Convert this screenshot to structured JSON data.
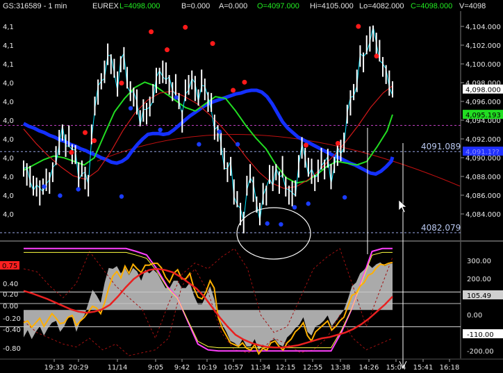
{
  "header": {
    "symbol": "GS:316589 - 1 min",
    "exchange": "EUREX",
    "last": "L=4098.000",
    "bid": "B=0.000",
    "ask": "A=0.000",
    "open": "O=4097.000",
    "high": "Hi=4105.000",
    "low": "Lo=4082.000",
    "close": "C=4098.000",
    "volume": "V=4098"
  },
  "colors": {
    "background": "#000000",
    "price_bars": "#ffffff",
    "price_line": "#00e5ff",
    "blue_ma": "#1430ff",
    "green_ma": "#22dd22",
    "red_ma": "#d01818",
    "swing_high_dot": "#ff1a1a",
    "swing_low_dot": "#1a3cff",
    "osc_main": "#ffb000",
    "osc_fill": "#c8c8c8",
    "osc_magenta": "#ff40ff",
    "osc_yellow": "#ffff40"
  },
  "chart_data": [
    {
      "type": "line",
      "panel": "price",
      "title": "",
      "ylim": [
        4082,
        4106
      ],
      "y_ticks_right": [
        "4,104.000",
        "4,102.000",
        "4,100.000",
        "4,098.000",
        "4,096.000",
        "4,094.000",
        "4,092.000",
        "4,090.000",
        "4,088.000",
        "4,086.000",
        "4,084.000"
      ],
      "y_ticks_left": [
        "4,1",
        "4,1",
        "4,1",
        "4,0",
        "4,0",
        "4,0",
        "4,0",
        "4,0",
        "4,0",
        "4,0",
        "4,0"
      ],
      "price_badges": [
        {
          "label": "4,098.000",
          "value": 4098.0,
          "bg": "#ffffff",
          "fg": "#000000"
        },
        {
          "label": "4,095.193",
          "value": 4095.19,
          "bg": "#22dd22",
          "fg": "#000000"
        },
        {
          "label": "4,091.1??",
          "value": 4091.1,
          "bg": "#2030ff",
          "fg": "#9090ff"
        }
      ],
      "horizontal_levels": [
        {
          "label": "4091.089",
          "value": 4091.089
        },
        {
          "label": "4082.079",
          "value": 4082.079
        }
      ],
      "dashed_magenta_level": 4094.0,
      "close_series": [
        4089.2,
        4088.6,
        4088.0,
        4087.5,
        4087.0,
        4086.4,
        4087.2,
        4088.0,
        4087.3,
        4089.0,
        4090.5,
        4092.0,
        4093.2,
        4091.8,
        4092.5,
        4091.0,
        4090.6,
        4088.4,
        4089.2,
        4088.2,
        4087.0,
        4093.2,
        4096.0,
        4097.6,
        4098.9,
        4100.0,
        4101.6,
        4101.0,
        4100.2,
        4098.5,
        4100.8,
        4101.5,
        4099.0,
        4098.0,
        4097.0,
        4096.5,
        4094.8,
        4095.7,
        4095.0,
        4096.3,
        4097.4,
        4098.9,
        4099.5,
        4100.0,
        4099.5,
        4098.7,
        4097.6,
        4098.2,
        4096.7,
        4094.5,
        4097.6,
        4098.7,
        4098.9,
        4098.0,
        4097.1,
        4099.0,
        4097.7,
        4096.8,
        4096.4,
        4093.7,
        4093.1,
        4092.0,
        4090.0,
        4089.0,
        4089.3,
        4086.5,
        4085.8,
        4084.2,
        4082.9,
        4087.5,
        4088.5,
        4086.8,
        4085.2,
        4084.2,
        4086.1,
        4086.4,
        4088.4,
        4088.0,
        4088.8,
        4087.7,
        4089.1,
        4087.4,
        4086.1,
        4086.3,
        4087.0,
        4089.5,
        4091.2,
        4090.6,
        4089.2,
        4088.8,
        4087.6,
        4089.0,
        4090.0,
        4089.3,
        4090.2,
        4088.2,
        4089.6,
        4090.8,
        4090.9,
        4092.3,
        4095.1,
        4096.4,
        4097.7,
        4099.0,
        4101.4,
        4101.2,
        4102.8,
        4103.5,
        4104.2,
        4103.1,
        4102.0,
        4100.7,
        4099.5,
        4098.6,
        4098.0
      ],
      "series": [
        {
          "name": "",
          "values": [
            4094.2,
            4093.9,
            4093.7,
            4093.4,
            4093.2,
            4092.9,
            4092.7,
            4092.4,
            4092.2,
            4091.9,
            4091.7,
            4091.4,
            4091.2,
            4090.9,
            4090.7,
            4090.4,
            4090.2,
            4089.9,
            4089.8,
            4090.0,
            4090.4,
            4091.2,
            4091.9,
            4092.5,
            4093.0,
            4093.1,
            4093.1,
            4093.0,
            4093.1,
            4093.5,
            4094.0,
            4094.5,
            4095.0,
            4095.4,
            4095.8,
            4096.2,
            4096.5,
            4096.7,
            4096.9,
            4097.1,
            4097.3,
            4097.5,
            4097.6,
            4097.8,
            4097.9,
            4097.9,
            4097.7,
            4097.2,
            4096.4,
            4095.4,
            4094.4,
            4093.7,
            4093.2,
            4092.7,
            4092.4,
            4092.1,
            4091.8,
            4091.5,
            4091.2,
            4090.9,
            4090.6,
            4090.4,
            4090.1,
            4089.8,
            4089.6,
            4089.3,
            4089.0,
            4088.7,
            4088.6,
            4088.9,
            4089.4,
            4090.0,
            4090.5
          ],
          "x_start": 0,
          "x_step": 1.6
        },
        {
          "name": "",
          "values": [
            4089.0,
            4089.6,
            4090.2,
            4090.6,
            4090.4,
            4090.0,
            4089.6,
            4090.4,
            4093.0,
            4095.5,
            4097.0,
            4098.2,
            4098.8,
            4098.4,
            4097.6,
            4096.8,
            4096.0,
            4095.6,
            4096.4,
            4097.2,
            4097.0,
            4095.6,
            4094.0,
            4092.6,
            4091.4,
            4089.6,
            4088.2,
            4087.6,
            4087.8,
            4088.5,
            4089.4,
            4090.0,
            4089.8,
            4089.6,
            4090.0,
            4091.6,
            4093.4,
            4095.2
          ],
          "x_start": 0,
          "x_step": 3.12
        },
        {
          "name": "",
          "values": [
            4093.6,
            4092.0,
            4090.6,
            4089.4,
            4088.4,
            4088.0,
            4089.0,
            4091.0,
            4093.4,
            4095.4,
            4096.8,
            4097.6,
            4097.8,
            4097.2,
            4096.4,
            4095.2,
            4093.8,
            4092.2,
            4090.4,
            4088.8,
            4087.6,
            4087.0,
            4087.2,
            4088.0,
            4089.2,
            4090.6,
            4092.2,
            4094.0,
            4096.0,
            4097.6,
            4098.4
          ],
          "x_start": 0,
          "x_step": 3.83
        }
      ],
      "swing_highs": [
        {
          "x": 21,
          "y": 4091.0
        },
        {
          "x": 27,
          "y": 4093.2
        },
        {
          "x": 31,
          "y": 4092.3
        },
        {
          "x": 43,
          "y": 4098.7
        },
        {
          "x": 56,
          "y": 4104.4
        },
        {
          "x": 63,
          "y": 4102.4
        },
        {
          "x": 71,
          "y": 4104.9
        },
        {
          "x": 83,
          "y": 4103.1
        },
        {
          "x": 92,
          "y": 4097.9
        },
        {
          "x": 97,
          "y": 4098.8
        },
        {
          "x": 124,
          "y": 4091.8
        },
        {
          "x": 138,
          "y": 4092.0
        },
        {
          "x": 147,
          "y": 4105.0
        },
        {
          "x": 155,
          "y": 4101.7
        }
      ],
      "swing_lows": [
        {
          "x": 9,
          "y": 4087.2
        },
        {
          "x": 16,
          "y": 4086.2
        },
        {
          "x": 24,
          "y": 4086.9
        },
        {
          "x": 43,
          "y": 4086.1
        },
        {
          "x": 47,
          "y": 4095.9
        },
        {
          "x": 60,
          "y": 4093.5
        },
        {
          "x": 67,
          "y": 4097.1
        },
        {
          "x": 77,
          "y": 4091.9
        },
        {
          "x": 86,
          "y": 4093.3
        },
        {
          "x": 94,
          "y": 4091.9
        },
        {
          "x": 107,
          "y": 4083.1
        },
        {
          "x": 113,
          "y": 4083.0
        },
        {
          "x": 119,
          "y": 4084.9
        },
        {
          "x": 125,
          "y": 4085.3
        },
        {
          "x": 141,
          "y": 4086.0
        }
      ]
    },
    {
      "type": "area",
      "panel": "oscillator",
      "title": "",
      "ylim_left": [
        -0.9,
        0.9
      ],
      "ylim_right": [
        -250,
        320
      ],
      "y_ticks_left": [
        "0.75",
        "0.40",
        "0.20",
        "0.00",
        "-0.20",
        "-0.40",
        "-0.80"
      ],
      "y_ticks_right": [
        "300.00",
        "200.00",
        "100.00",
        "0.00",
        "-100.00",
        "-200.00"
      ],
      "badges": [
        {
          "label": "0.75",
          "bg": "#ff2020"
        },
        {
          "label": "105.49",
          "bg": "#d0d0d0"
        },
        {
          "label": "-110.00",
          "bg": "#ffffff"
        }
      ],
      "horizontal_levels": [
        0.2,
        0.0,
        -0.4
      ],
      "main_series": [
        -70,
        -60,
        -95,
        -70,
        -45,
        -90,
        -55,
        -20,
        -45,
        -75,
        -70,
        -40,
        -30,
        -85,
        -60,
        -40,
        -10,
        20,
        10,
        -20,
        40,
        120,
        185,
        210,
        175,
        240,
        200,
        250,
        225,
        205,
        245,
        245,
        255,
        255,
        230,
        180,
        150,
        200,
        220,
        170,
        170,
        200,
        120,
        70,
        60,
        100,
        160,
        120,
        -40,
        -100,
        -140,
        -180,
        -190,
        -200,
        -180,
        -210,
        -220,
        -190,
        -240,
        -210,
        -220,
        -180,
        -170,
        -200,
        -220,
        -180,
        -160,
        -120,
        -100,
        -70,
        -140,
        -170,
        -120,
        -100,
        -80,
        -60,
        -110,
        -90,
        -60,
        -40,
        20,
        80,
        90,
        130,
        150,
        190,
        200,
        230,
        250,
        245,
        255,
        260
      ],
      "fill_series": [
        -150,
        -110,
        -160,
        -120,
        -90,
        -140,
        -100,
        -70,
        -60,
        -120,
        -90,
        -40,
        -40,
        -120,
        -60,
        -30,
        40,
        110,
        80,
        40,
        150,
        230,
        225,
        240,
        200,
        230,
        190,
        230,
        210,
        160,
        220,
        200,
        220,
        200,
        160,
        120,
        120,
        160,
        160,
        120,
        120,
        150,
        80,
        30,
        30,
        80,
        130,
        60,
        -40,
        -80,
        -120,
        -170,
        -180,
        -200,
        -160,
        -200,
        -200,
        -160,
        -220,
        -190,
        -210,
        -170,
        -160,
        -190,
        -200,
        -150,
        -130,
        -100,
        -80,
        -40,
        -120,
        -140,
        -90,
        -80,
        -60,
        -30,
        -90,
        -60,
        -30,
        0,
        60,
        130,
        150,
        200,
        220,
        250,
        230,
        250,
        260,
        240,
        250,
        255
      ],
      "red_series": [
        0.22,
        0.18,
        0.13,
        0.08,
        0.02,
        -0.04,
        -0.1,
        -0.14,
        -0.16,
        -0.14,
        -0.1,
        -0.02,
        0.12,
        0.28,
        0.42,
        0.52,
        0.58,
        0.6,
        0.58,
        0.54,
        0.46,
        0.36,
        0.26,
        0.12,
        -0.06,
        -0.24,
        -0.4,
        -0.54,
        -0.62,
        -0.68,
        -0.72,
        -0.75,
        -0.76,
        -0.76,
        -0.74,
        -0.72,
        -0.68,
        -0.64,
        -0.6,
        -0.58,
        -0.54,
        -0.5,
        -0.44,
        -0.36,
        -0.26,
        -0.14,
        -0.02,
        0.12
      ],
      "envelope_series": [
        0.95,
        0.95,
        0.95,
        0.95,
        0.95,
        0.95,
        0.95,
        0.95,
        0.95,
        0.95,
        0.95,
        0.9,
        0.84,
        0.6,
        0.3,
        0.1,
        -0.3,
        -0.7,
        -0.8,
        -0.82,
        -0.82,
        -0.82,
        -0.82,
        -0.82,
        -0.82,
        -0.82,
        -0.82,
        -0.82,
        -0.82,
        -0.82,
        -0.82,
        -0.5,
        -0.1,
        0.4,
        0.9,
        0.95,
        0.95
      ],
      "upper_dashed_series": [
        0.6,
        0.55,
        0.3,
        0.1,
        0.35,
        0.9,
        0.6,
        0.3,
        0.1,
        -0.1,
        -0.6,
        0.0,
        0.5,
        0.7,
        0.6,
        0.8,
        0.95,
        0.6,
        -0.2,
        -0.5,
        -0.4,
        0.1,
        0.6,
        0.8,
        0.95,
        0.3,
        -0.4,
        0.2,
        0.8
      ],
      "lower_dashed_series": [
        -0.3,
        -0.5,
        -0.6,
        -0.7,
        -0.75,
        -0.6,
        -0.8,
        -0.7,
        -0.9,
        -0.85,
        -0.8,
        -0.6,
        0.3,
        0.6,
        0.2,
        -0.5,
        -0.8,
        -0.85,
        -0.8,
        -0.6,
        -0.7,
        -0.85,
        -0.8,
        -0.6,
        -0.2,
        -0.6,
        -0.8,
        -0.7,
        -0.6
      ]
    }
  ],
  "x_axis": {
    "tick_labels": [
      "19:33",
      "20:29",
      "11/14",
      "9:05",
      "9:42",
      "10:19",
      "10:57",
      "11:34",
      "12:15",
      "12:55",
      "13:38",
      "14:26",
      "15:04",
      "15:41",
      "16:18"
    ]
  }
}
